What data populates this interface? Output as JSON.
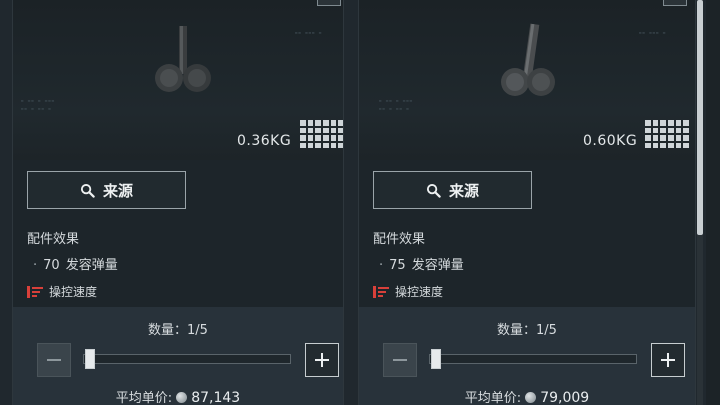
{
  "cards": [
    {
      "weight": "0.36KG",
      "source_label": "来源",
      "effects_title": "配件效果",
      "effect_value": "70",
      "effect_text": "发容弹量",
      "negative_text": "操控速度",
      "quantity_label": "数量：1/5",
      "quantity": 1,
      "quantity_max": 5,
      "price_label": "平均单价:",
      "price_value": "87,143"
    },
    {
      "weight": "0.60KG",
      "source_label": "来源",
      "effects_title": "配件效果",
      "effect_value": "75",
      "effect_text": "发容弹量",
      "negative_text": "操控速度",
      "quantity_label": "数量：1/5",
      "quantity": 1,
      "quantity_max": 5,
      "price_label": "平均单价:",
      "price_value": "79,009"
    }
  ],
  "icons": {
    "source": "search-icon",
    "negative": "negative-stat-icon",
    "size_grid": "grid-size-icon",
    "currency": "coin-icon",
    "decrease": "minus-icon",
    "increase": "plus-icon"
  },
  "colors": {
    "negative_stat": "#d8403a",
    "panel_bg": "#1e262b",
    "bottom_bg": "#28323a"
  }
}
